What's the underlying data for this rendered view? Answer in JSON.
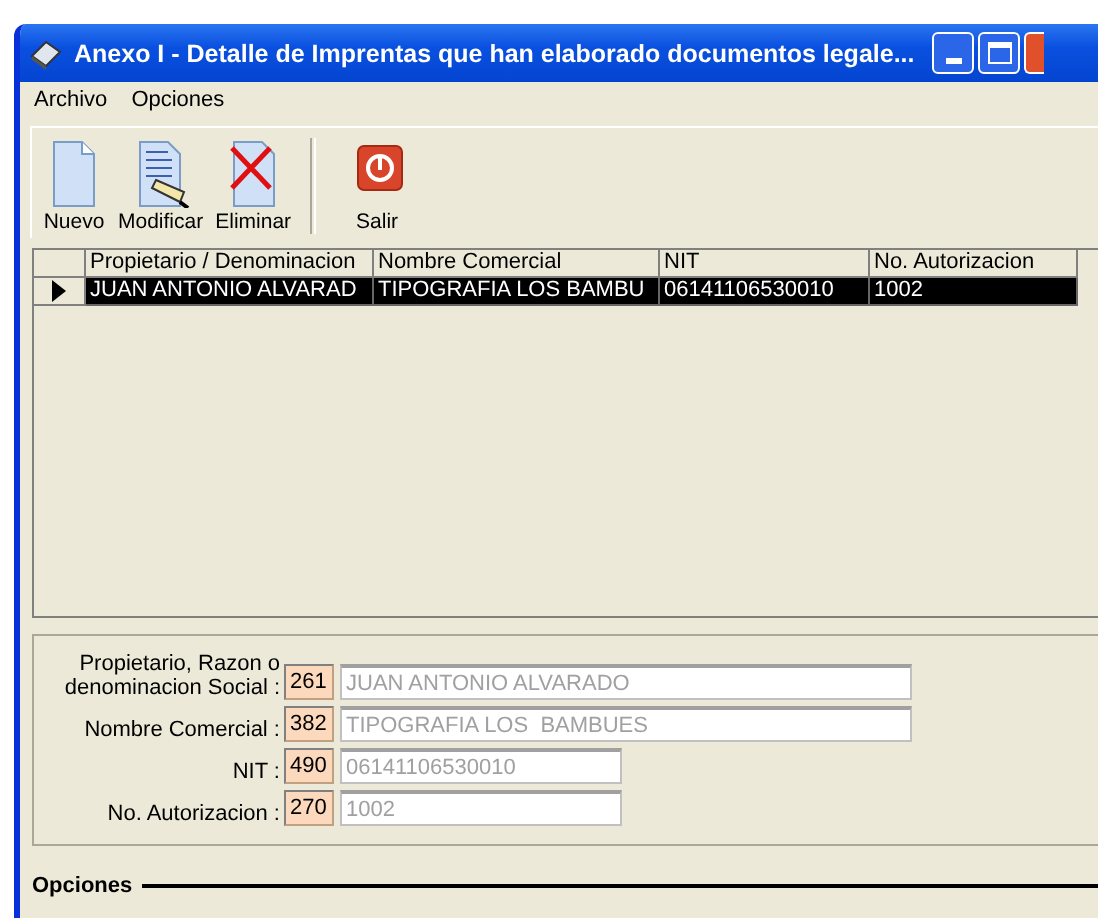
{
  "window": {
    "title": "Anexo I - Detalle de Imprentas que han elaborado documentos legale..."
  },
  "menu": [
    "Archivo",
    "Opciones"
  ],
  "toolbar": [
    {
      "label": "Nuevo",
      "kind": "new"
    },
    {
      "label": "Modificar",
      "kind": "edit"
    },
    {
      "label": "Eliminar",
      "kind": "delete"
    },
    {
      "label": "Salir",
      "kind": "exit"
    }
  ],
  "table": {
    "columns": [
      "Propietario / Denominacion",
      "Nombre Comercial",
      "NIT",
      "No. Autorizacion"
    ],
    "rows": [
      {
        "cells": [
          "JUAN ANTONIO ALVARAD",
          "TIPOGRAFIA LOS  BAMBU",
          "06141106530010",
          "1002"
        ],
        "selected": true
      }
    ]
  },
  "form": [
    {
      "label": "Propietario, Razon o denominacion Social :",
      "code": "261",
      "value": "JUAN ANTONIO ALVARADO",
      "kind": "wide"
    },
    {
      "label": "Nombre Comercial :",
      "code": "382",
      "value": "TIPOGRAFIA LOS  BAMBUES",
      "kind": "wide"
    },
    {
      "label": "NIT :",
      "code": "490",
      "value": "06141106530010",
      "kind": "narrow"
    },
    {
      "label": "No. Autorizacion :",
      "code": "270",
      "value": "1002",
      "kind": "narrow"
    }
  ],
  "section": "Opciones"
}
